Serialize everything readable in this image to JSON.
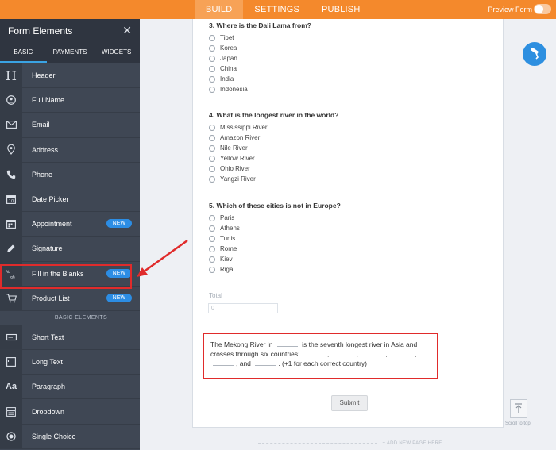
{
  "topbar": {
    "tabs": [
      {
        "label": "BUILD",
        "active": true
      },
      {
        "label": "SETTINGS",
        "active": false
      },
      {
        "label": "PUBLISH",
        "active": false
      }
    ],
    "preview_label": "Preview Form"
  },
  "panel": {
    "title": "Form Elements",
    "tabs": [
      "BASIC",
      "PAYMENTS",
      "WIDGETS"
    ],
    "items": [
      {
        "label": "Header",
        "icon": "header-icon"
      },
      {
        "label": "Full Name",
        "icon": "person-icon"
      },
      {
        "label": "Email",
        "icon": "envelope-icon"
      },
      {
        "label": "Address",
        "icon": "map-pin-icon"
      },
      {
        "label": "Phone",
        "icon": "phone-icon"
      },
      {
        "label": "Date Picker",
        "icon": "calendar-icon"
      },
      {
        "label": "Appointment",
        "icon": "appointment-icon",
        "badge": "NEW"
      },
      {
        "label": "Signature",
        "icon": "pen-icon"
      },
      {
        "label": "Fill in the Blanks",
        "icon": "fill-blanks-icon",
        "badge": "NEW"
      },
      {
        "label": "Product List",
        "icon": "cart-icon",
        "badge": "NEW"
      }
    ],
    "section_label": "BASIC ELEMENTS",
    "basic_items": [
      {
        "label": "Short Text",
        "icon": "short-text-icon"
      },
      {
        "label": "Long Text",
        "icon": "long-text-icon"
      },
      {
        "label": "Paragraph",
        "icon": "paragraph-icon"
      },
      {
        "label": "Dropdown",
        "icon": "dropdown-icon"
      },
      {
        "label": "Single Choice",
        "icon": "radio-icon"
      }
    ]
  },
  "form": {
    "questions": [
      {
        "title": "3. Where is the Dali Lama from?",
        "options": [
          "Tibet",
          "Korea",
          "Japan",
          "China",
          "India",
          "Indonesia"
        ]
      },
      {
        "title": "4. What is the longest river in the world?",
        "options": [
          "Mississippi River",
          "Amazon River",
          "Nile River",
          "Yellow River",
          "Ohio River",
          "Yangzi River"
        ]
      },
      {
        "title": "5. Which of these cities is not in Europe?",
        "options": [
          "Paris",
          "Athens",
          "Tunis",
          "Rome",
          "Kiev",
          "Riga"
        ]
      }
    ],
    "total_label": "Total",
    "total_value": "0",
    "fill_blank": {
      "part1": "The Mekong River in",
      "part2": "is the seventh longest river in Asia and crosses through six countries:",
      "sep_comma": ",",
      "sep_and": ", and",
      "part3": ". (+1 for each correct country)"
    },
    "submit_label": "Submit"
  },
  "add_page_label": "+ ADD NEW PAGE HERE",
  "scroll_label": "Scroll to top",
  "colors": {
    "accent": "#f4892c",
    "panel": "#3f4754",
    "badge": "#2c8de4",
    "highlight": "#e02b2b"
  }
}
